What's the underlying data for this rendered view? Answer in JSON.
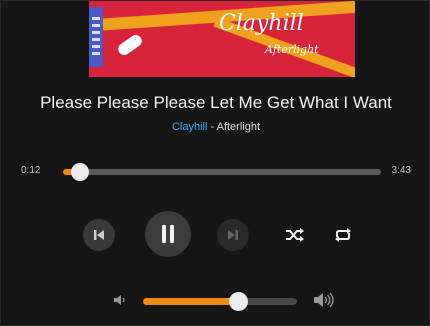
{
  "album_art": {
    "logo_text": "Clayhill",
    "logo_subtext": "Afterlight"
  },
  "track": {
    "title": "Please Please Please Let Me Get What I Want",
    "artist": "Clayhill",
    "separator": " - ",
    "album": "Afterlight"
  },
  "playback": {
    "elapsed": "0:12",
    "duration": "3:43",
    "progress_fraction": 0.054,
    "state": "playing"
  },
  "controls": {
    "previous_icon": "skip-previous-icon",
    "play_pause_icon": "pause-icon",
    "next_icon": "skip-next-icon",
    "shuffle_icon": "shuffle-icon",
    "repeat_icon": "repeat-icon"
  },
  "volume": {
    "level_fraction": 0.62,
    "low_icon": "volume-low-icon",
    "high_icon": "volume-high-icon"
  },
  "colors": {
    "accent": "#f08a14",
    "artist_link": "#3aa6ff",
    "background": "#161616",
    "album_art_red": "#d8243b",
    "album_art_yellow": "#f0a21c"
  }
}
